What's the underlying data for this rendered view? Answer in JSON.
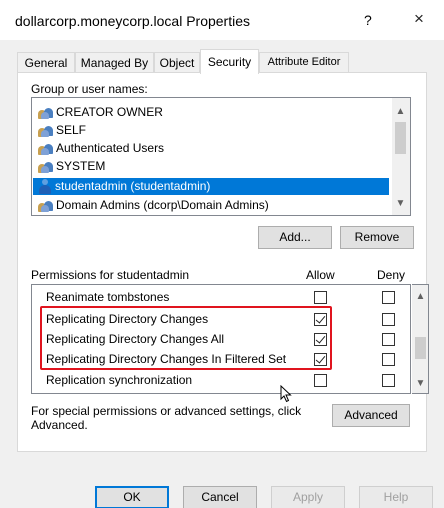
{
  "window": {
    "title": "dollarcorp.moneycorp.local Properties",
    "help_glyph": "?",
    "close_glyph": "×"
  },
  "tabs": [
    {
      "label": "General",
      "active": false
    },
    {
      "label": "Managed By",
      "active": false
    },
    {
      "label": "Object",
      "active": false
    },
    {
      "label": "Security",
      "active": true
    },
    {
      "label": "Attribute Editor",
      "active": false
    }
  ],
  "security": {
    "group_label": "Group or user names:",
    "principals": [
      {
        "name": "CREATOR OWNER",
        "icon": "group-icon",
        "selected": false
      },
      {
        "name": "SELF",
        "icon": "group-icon",
        "selected": false
      },
      {
        "name": "Authenticated Users",
        "icon": "group-icon",
        "selected": false
      },
      {
        "name": "SYSTEM",
        "icon": "group-icon",
        "selected": false
      },
      {
        "name": "studentadmin (studentadmin)",
        "icon": "user-icon",
        "selected": true
      },
      {
        "name": "Domain Admins (dcorp\\Domain Admins)",
        "icon": "group-icon",
        "selected": false
      }
    ],
    "add_label": "Add...",
    "remove_label": "Remove",
    "permissions_label": "Permissions for studentadmin",
    "allow_header": "Allow",
    "deny_header": "Deny",
    "permissions": [
      {
        "name": "Reanimate tombstones",
        "allow": false,
        "deny": false
      },
      {
        "name": "Replicating Directory Changes",
        "allow": true,
        "deny": false
      },
      {
        "name": "Replicating Directory Changes All",
        "allow": true,
        "deny": false
      },
      {
        "name": "Replicating Directory Changes In Filtered Set",
        "allow": true,
        "deny": false
      },
      {
        "name": "Replication synchronization",
        "allow": false,
        "deny": false
      }
    ],
    "special_note": "For special permissions or advanced settings, click Advanced.",
    "advanced_label": "Advanced"
  },
  "footer": {
    "ok_label": "OK",
    "cancel_label": "Cancel",
    "apply_label": "Apply",
    "help_label": "Help"
  },
  "colors": {
    "selection": "#0078d7",
    "highlight_border": "#e0141e"
  }
}
